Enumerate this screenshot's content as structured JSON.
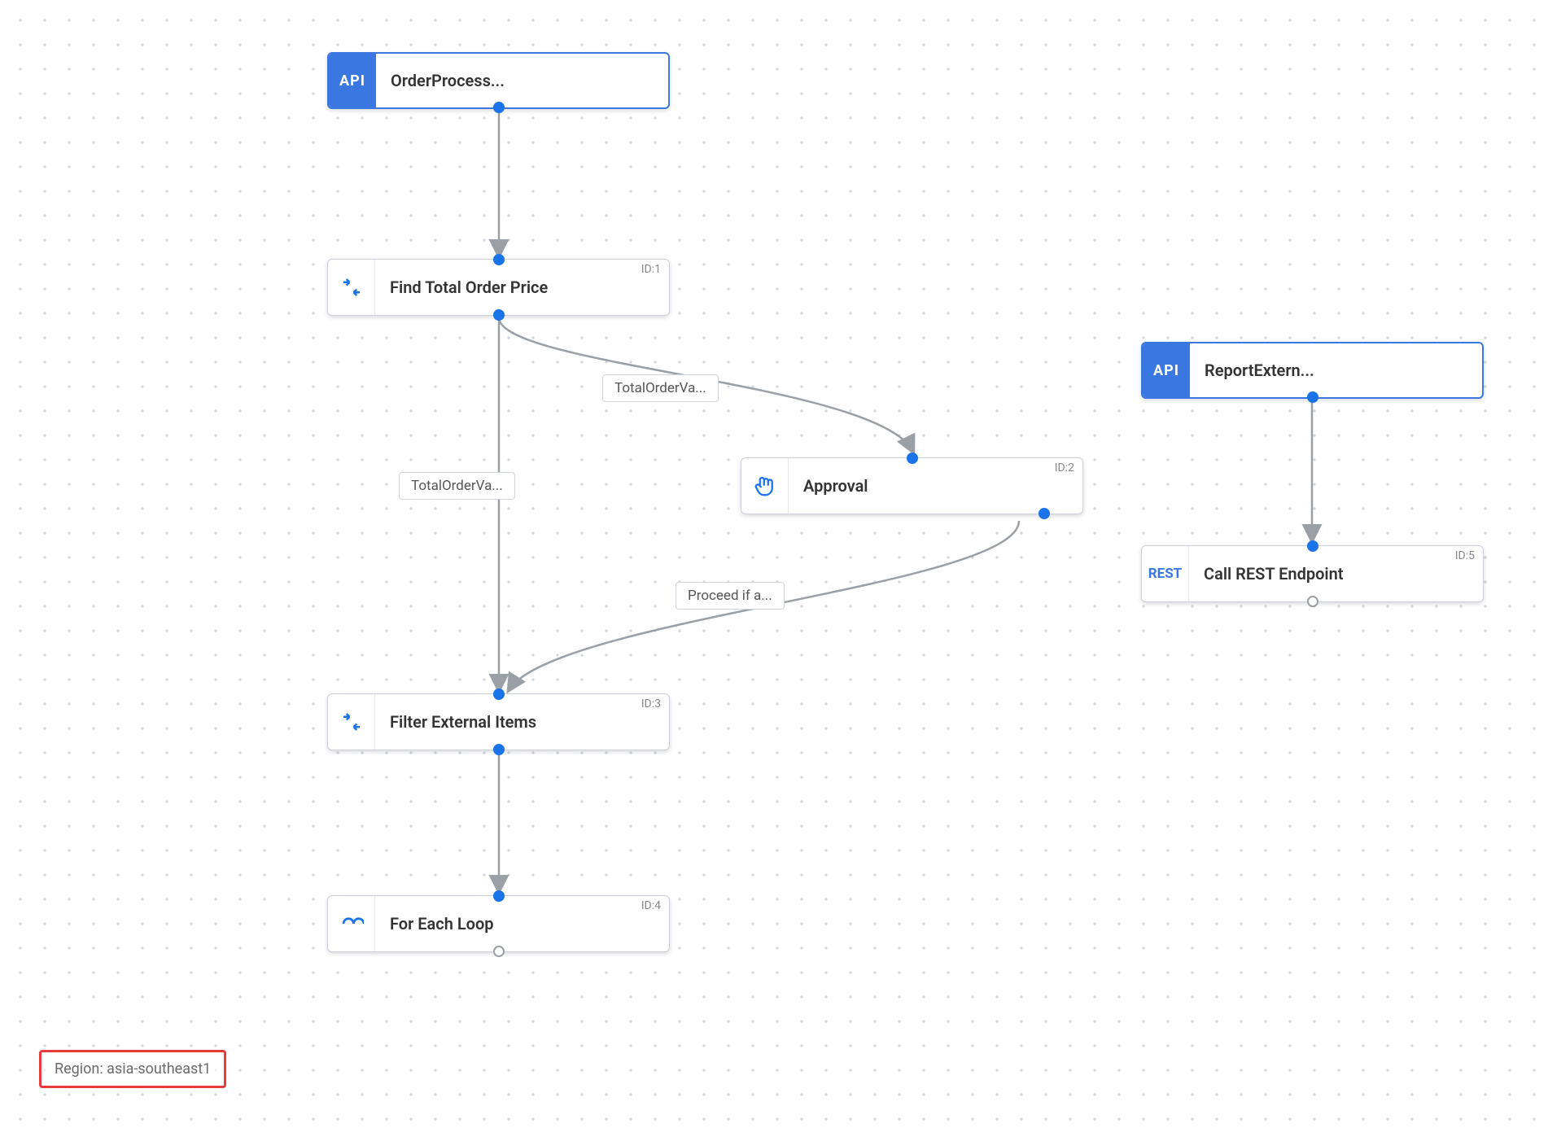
{
  "canvas": {
    "region_label": "Region: asia-southeast1"
  },
  "nodes": {
    "trigger1": {
      "icon": "API",
      "label": "OrderProcess..."
    },
    "task1": {
      "icon": "merge",
      "label": "Find Total Order Price",
      "id": "ID:1"
    },
    "task2": {
      "icon": "hand",
      "label": "Approval",
      "id": "ID:2"
    },
    "task3": {
      "icon": "merge",
      "label": "Filter External Items",
      "id": "ID:3"
    },
    "task4": {
      "icon": "loop",
      "label": "For Each Loop",
      "id": "ID:4"
    },
    "trigger2": {
      "icon": "API",
      "label": "ReportExtern..."
    },
    "task5": {
      "icon": "REST",
      "label": "Call REST Endpoint",
      "id": "ID:5"
    }
  },
  "edges": {
    "e1": {
      "label": "TotalOrderVa..."
    },
    "e2": {
      "label": "TotalOrderVa..."
    },
    "e3": {
      "label": "Proceed if a..."
    }
  }
}
